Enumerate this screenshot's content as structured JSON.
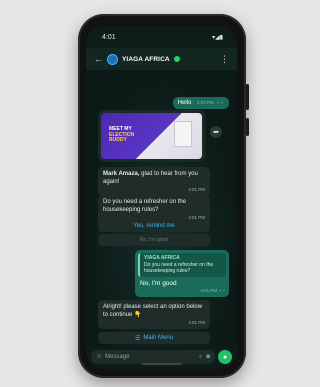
{
  "status_bar": {
    "time": "4:01",
    "indicators": "▾◢▮"
  },
  "header": {
    "back_icon": "←",
    "title": "YIAGA AFRICA",
    "menu_icon": "⋮"
  },
  "messages": {
    "hello": {
      "text": "Hello",
      "time": "4:00 PM",
      "ticks": "✓✓"
    },
    "image": {
      "line1": "Meet my",
      "line2": "Election",
      "line3": "Buddy"
    },
    "m1": {
      "bold": "Mark Amaza,",
      "text": " glad to hear from you again!",
      "time": "4:01 PM"
    },
    "m2": {
      "text": "Do you need a refresher on the housekeeping rules?",
      "time": "4:01 PM"
    },
    "quick_yes": "Yes, remind me",
    "quick_no": "No, I'm good",
    "reply": {
      "quote_sender": "YIAGA AFRICA",
      "quote_text": "Do you need a refresher on the housekeeping rules?",
      "text": "No, I'm good",
      "time": "4:01 PM",
      "ticks": "✓✓"
    },
    "m3": {
      "text": "Alright! please select an option below to continue 👇",
      "time": "4:01 PM"
    },
    "main_menu": "Main Menu",
    "main_menu_icon": "☰"
  },
  "input": {
    "placeholder": "Message",
    "emoji_icon": "☺",
    "attach_icon": "⌕",
    "camera_icon": "◙",
    "mic_icon": "●"
  },
  "colors": {
    "bubble_out": "#1a6b5a",
    "bubble_in": "#1f2c2a",
    "link": "#41b5e8",
    "accent_green": "#21c063"
  }
}
